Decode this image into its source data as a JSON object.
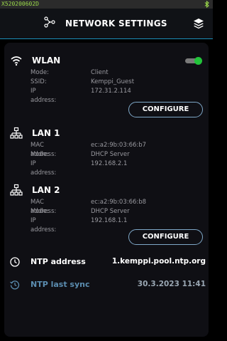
{
  "status_bar": {
    "serial": "X520200602D",
    "bt_icon": "bluetooth-icon"
  },
  "header": {
    "title": "NETWORK SETTINGS",
    "icon": "network-icon",
    "menu_icon": "layers-icon"
  },
  "wlan": {
    "title": "WLAN",
    "enabled": true,
    "rows": [
      {
        "key": "Mode:",
        "value": "Client"
      },
      {
        "key": "SSID:",
        "value": "Kemppi_Guest"
      },
      {
        "key": "IP address:",
        "value": "172.31.2.114"
      }
    ],
    "configure_label": "CONFIGURE"
  },
  "lan1": {
    "title": "LAN 1",
    "rows": [
      {
        "key": "MAC address:",
        "value": "ec:a2:9b:03:66:b7"
      },
      {
        "key": "Mode:",
        "value": "DHCP Server"
      },
      {
        "key": "IP address:",
        "value": "192.168.2.1"
      }
    ]
  },
  "lan2": {
    "title": "LAN 2",
    "rows": [
      {
        "key": "MAC address:",
        "value": "ec:a2:9b:03:66:b8"
      },
      {
        "key": "Mode:",
        "value": "DHCP Server"
      },
      {
        "key": "IP address:",
        "value": "192.168.1.1"
      }
    ],
    "configure_label": "CONFIGURE"
  },
  "ntp": {
    "address_label": "NTP address",
    "address_value": "1.kemppi.pool.ntp.org",
    "sync_label": "NTP last sync",
    "sync_value": "30.3.2023 11:41"
  },
  "colors": {
    "accent": "#1b8fb8",
    "toggle_on": "#22c43a",
    "muted": "#5b8db0"
  }
}
